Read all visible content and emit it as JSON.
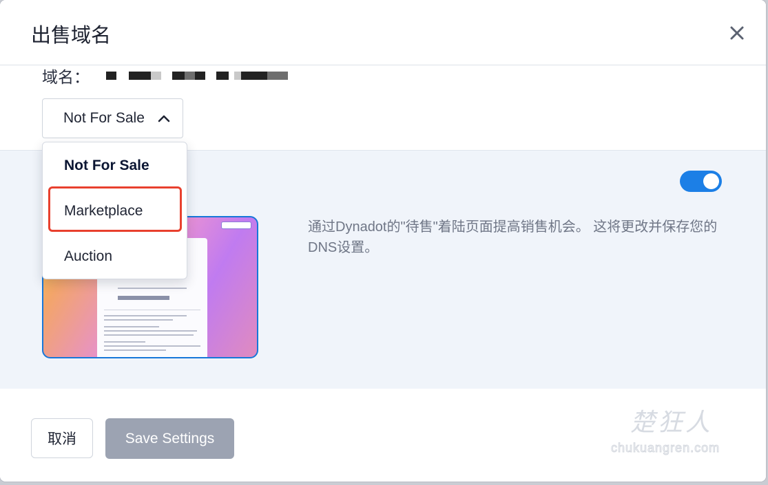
{
  "modal": {
    "title": "出售域名",
    "close_icon": "close-icon"
  },
  "domain": {
    "label": "域名："
  },
  "sale_select": {
    "value": "Not For Sale",
    "icon": "chevron-up-icon",
    "options": [
      "Not For Sale",
      "Marketplace",
      "Auction"
    ],
    "selected_index": 0,
    "highlighted_index": 1
  },
  "settings": {
    "toggle_on": true,
    "description": "通过Dynadot的\"待售\"着陆页面提高销售机会。 这将更改并保存您的DNS设置。"
  },
  "footer": {
    "cancel_label": "取消",
    "save_label": "Save Settings"
  },
  "watermark": {
    "cn": "楚狂人",
    "en": "chukuangren.com"
  },
  "colors": {
    "accent": "#1c7fe6",
    "highlight_border": "#e8402e",
    "disabled_button": "#9ca3b2"
  }
}
